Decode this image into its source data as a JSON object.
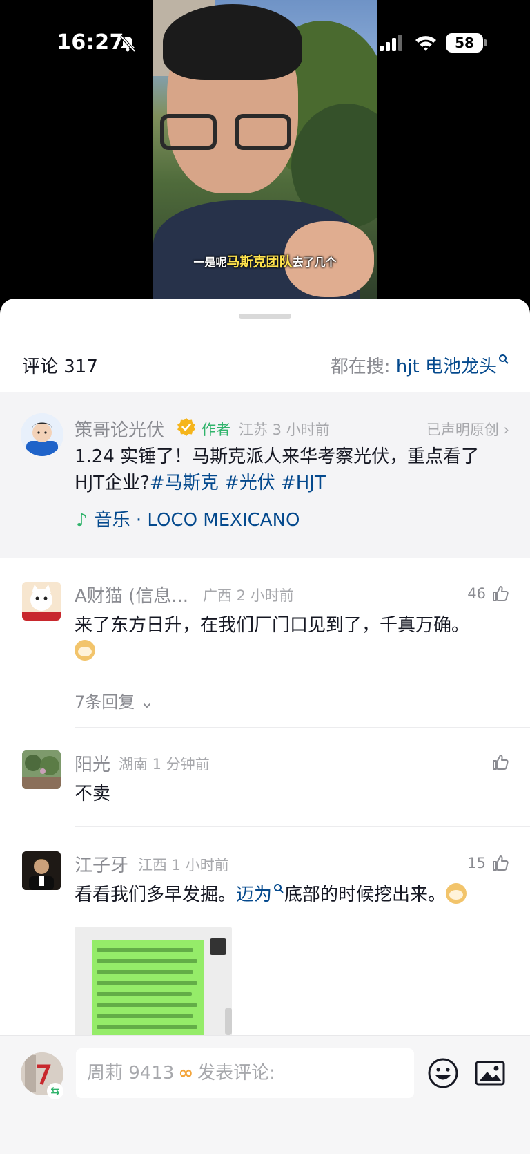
{
  "status_bar": {
    "time": "16:27",
    "battery": "58"
  },
  "video": {
    "subtitle_prefix": "一是呢",
    "subtitle_highlight": "马斯克团队",
    "subtitle_suffix": "去了几个"
  },
  "header": {
    "comment_count_label": "评论 317",
    "hot_search_label": "都在搜: ",
    "hot_search_keyword": "hjt 电池龙头"
  },
  "author_post": {
    "name": "策哥论光伏",
    "tag": "作者",
    "meta": "江苏 3 小时前",
    "original_claim": "已声明原创 ›",
    "text": "1.24 实锤了！马斯克派人来华考察光伏，重点看了HJT企业?",
    "hashtags": "#马斯克 #光伏 #HJT",
    "music_label": "音乐 · LOCO MEXICANO"
  },
  "comments": [
    {
      "name": "A财猫 (信息...",
      "meta": "广西 2 小时前",
      "likes": "46",
      "text": "来了东方日升，在我们厂门口见到了，千真万确。",
      "replies": "7条回复 ⌄"
    },
    {
      "name": "阳光",
      "meta": "湖南 1 分钟前",
      "likes": "",
      "text": "不卖"
    },
    {
      "name": "江子牙",
      "meta": "江西 1 小时前",
      "likes": "15",
      "text_before": "看看我们多早发掘。",
      "keyword": "迈为",
      "text_after": "底部的时候挖出来。"
    }
  ],
  "input_bar": {
    "user": "周莉 9413",
    "placeholder": "发表评论:"
  },
  "colors": {
    "accent_link": "#04498d",
    "author_tag": "#2fb36b",
    "verified": "#f5b51c"
  }
}
